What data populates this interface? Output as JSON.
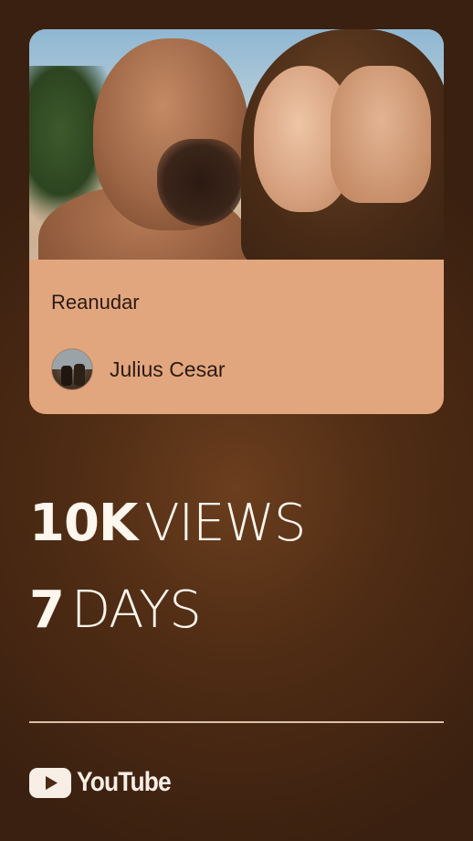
{
  "video_card": {
    "title": "Reanudar",
    "channel_name": "Julius Cesar",
    "card_color": "#e2a67f"
  },
  "stats": {
    "views_number": "10K",
    "views_unit": "VIEWS",
    "days_number": "7",
    "days_unit": "DAYS"
  },
  "footer": {
    "brand_label": "YouTube",
    "brand_icon": "youtube-play-icon"
  },
  "colors": {
    "background": "#4f2c14",
    "text": "#fff6ee",
    "divider": "#dcbfa8"
  }
}
